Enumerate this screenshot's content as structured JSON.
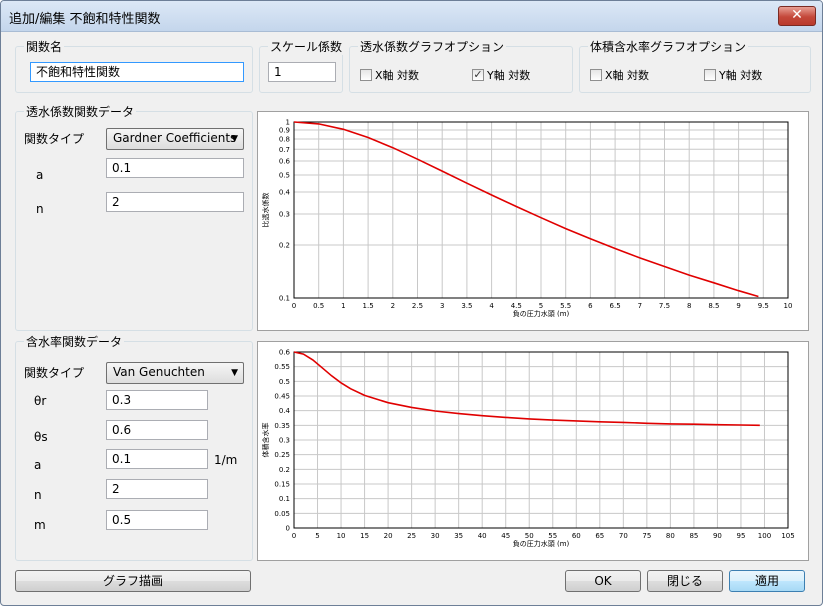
{
  "window": {
    "title": "追加/編集 不飽和特性関数",
    "close_glyph": "✕"
  },
  "function_name": {
    "label": "関数名",
    "value": "不飽和特性関数"
  },
  "scale_factor": {
    "label": "スケール係数",
    "value": "1"
  },
  "permeability_graph_options": {
    "label": "透水係数グラフオプション",
    "x_log_label": "X軸 対数",
    "y_log_label": "Y軸 対数",
    "x_log_checked": false,
    "y_log_checked": true
  },
  "water_content_graph_options": {
    "label": "体積含水率グラフオプション",
    "x_log_label": "X軸 対数",
    "y_log_label": "Y軸 対数",
    "x_log_checked": false,
    "y_log_checked": false
  },
  "permeability_data": {
    "label": "透水係数関数データ",
    "type_label": "関数タイプ",
    "type_value": "Gardner Coefficients",
    "params": [
      {
        "name": "a",
        "value": "0.1"
      },
      {
        "name": "n",
        "value": "2"
      }
    ]
  },
  "water_content_data": {
    "label": "含水率関数データ",
    "type_label": "関数タイプ",
    "type_value": "Van Genuchten",
    "params": [
      {
        "name": "θr",
        "value": "0.3",
        "unit": ""
      },
      {
        "name": "θs",
        "value": "0.6",
        "unit": ""
      },
      {
        "name": "a",
        "value": "0.1",
        "unit": "1/m"
      },
      {
        "name": "n",
        "value": "2",
        "unit": ""
      },
      {
        "name": "m",
        "value": "0.5",
        "unit": ""
      }
    ]
  },
  "buttons": {
    "draw_graph": "グラフ描画",
    "ok": "OK",
    "close": "閉じる",
    "apply": "適用"
  },
  "colors": {
    "curve": "#e00000",
    "grid": "#c8c8c8",
    "accent": "#3399ff"
  },
  "chart_data": [
    {
      "type": "line",
      "xlabel": "負の圧力水頭 (m)",
      "ylabel": "比透水係数",
      "xlim": [
        0,
        10
      ],
      "ylim": [
        0.1,
        1
      ],
      "y_scale": "log",
      "grid": true,
      "x_ticks": [
        "0",
        "0.5",
        "1",
        "1.5",
        "2",
        "2.5",
        "3",
        "3.5",
        "4",
        "4.5",
        "5",
        "5.5",
        "6",
        "6.5",
        "7",
        "7.5",
        "8",
        "8.5",
        "9",
        "9.5",
        "10"
      ],
      "y_ticks": [
        "0.1",
        "0.2",
        "0.3",
        "0.4",
        "0.5",
        "0.6",
        "0.7",
        "0.8",
        "0.9",
        "1"
      ],
      "series": [
        {
          "x": [
            0,
            0.5,
            1,
            1.5,
            2,
            2.5,
            3,
            3.5,
            4,
            4.5,
            5,
            5.5,
            6,
            6.5,
            7,
            7.5,
            8,
            8.5,
            9,
            9.4
          ],
          "values": [
            1,
            0.976,
            0.909,
            0.816,
            0.714,
            0.615,
            0.526,
            0.449,
            0.385,
            0.331,
            0.286,
            0.248,
            0.217,
            0.191,
            0.169,
            0.151,
            0.135,
            0.122,
            0.11,
            0.102
          ]
        }
      ]
    },
    {
      "type": "line",
      "xlabel": "負の圧力水頭 (m)",
      "ylabel": "体積含水率",
      "xlim": [
        0,
        105
      ],
      "ylim": [
        0,
        0.6
      ],
      "grid": true,
      "x_ticks": [
        "0",
        "5",
        "10",
        "15",
        "20",
        "25",
        "30",
        "35",
        "40",
        "45",
        "50",
        "55",
        "60",
        "65",
        "70",
        "75",
        "80",
        "85",
        "90",
        "95",
        "100",
        "105"
      ],
      "y_ticks": [
        "0",
        "0.05",
        "0.1",
        "0.15",
        "0.2",
        "0.25",
        "0.3",
        "0.35",
        "0.4",
        "0.45",
        "0.5",
        "0.55",
        "0.6"
      ],
      "series": [
        {
          "x": [
            0,
            2,
            4,
            6,
            8,
            10,
            12,
            15,
            20,
            25,
            30,
            35,
            40,
            45,
            50,
            55,
            60,
            65,
            70,
            75,
            80,
            85,
            90,
            95,
            99
          ],
          "values": [
            0.6,
            0.593,
            0.573,
            0.546,
            0.519,
            0.495,
            0.475,
            0.452,
            0.427,
            0.411,
            0.399,
            0.39,
            0.383,
            0.377,
            0.372,
            0.368,
            0.365,
            0.362,
            0.36,
            0.357,
            0.355,
            0.354,
            0.352,
            0.351,
            0.35
          ]
        }
      ]
    }
  ]
}
